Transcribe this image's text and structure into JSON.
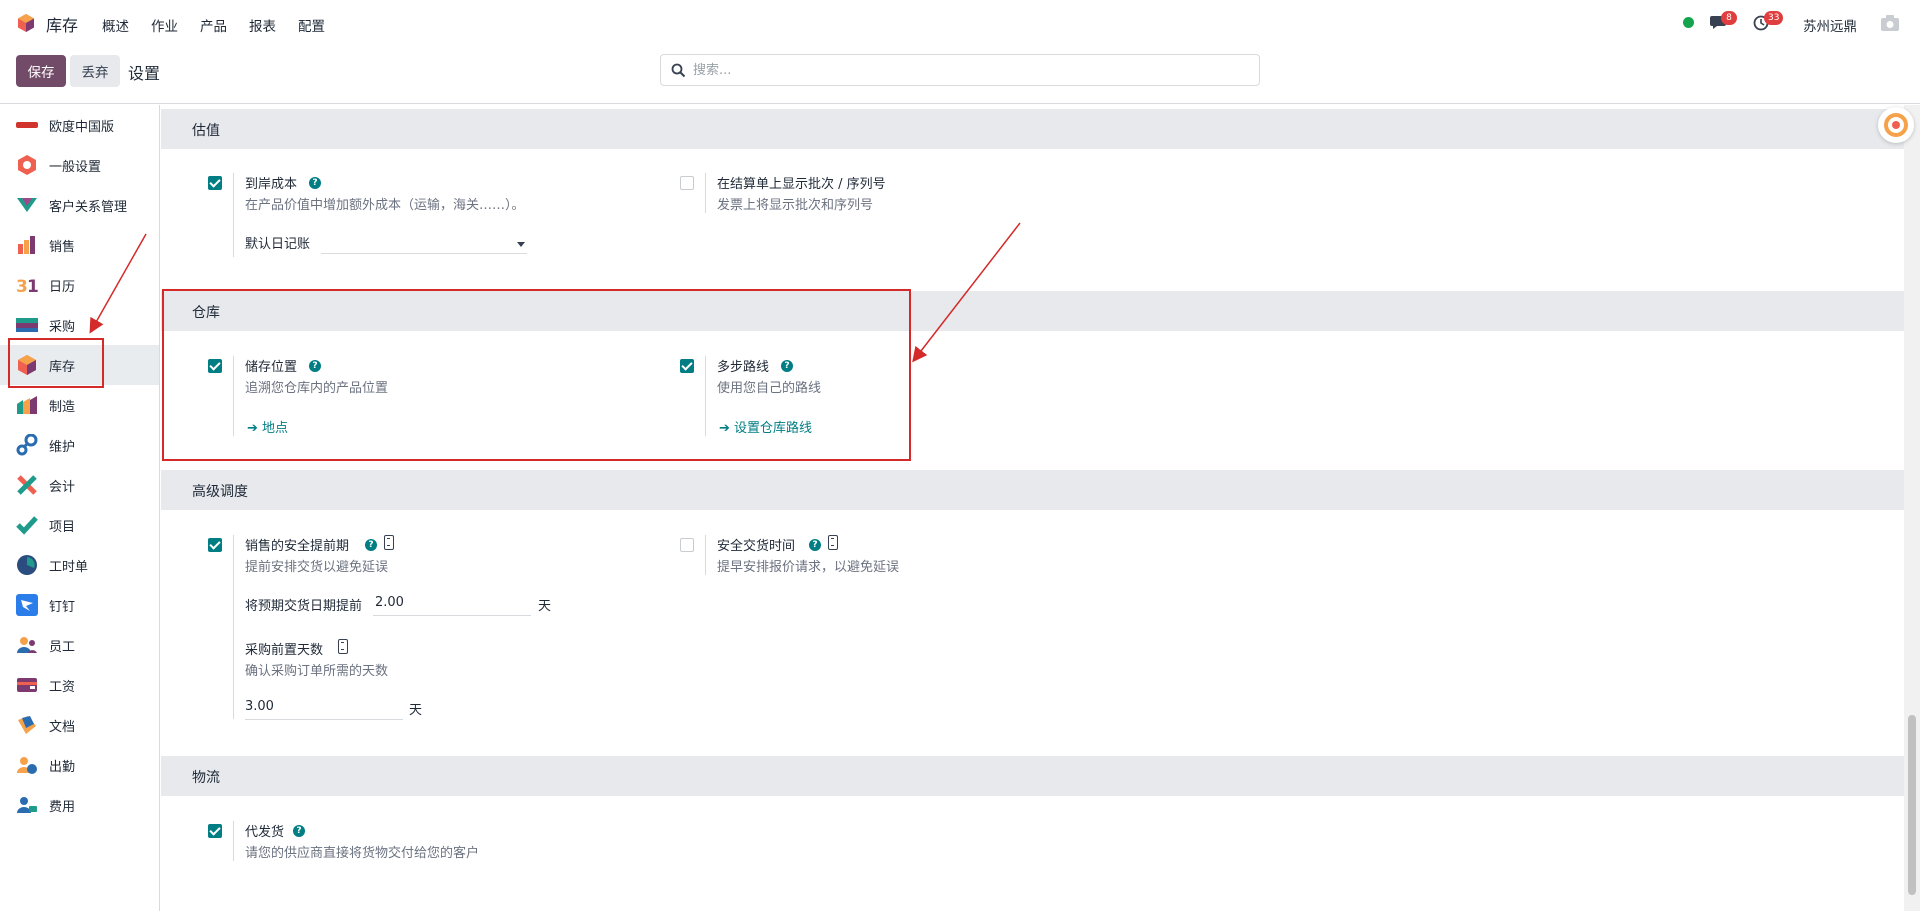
{
  "navbar": {
    "app_name": "库存",
    "menu": [
      "概述",
      "作业",
      "产品",
      "报表",
      "配置"
    ],
    "chat_count": "8",
    "activity_count": "33",
    "company": "苏州远鼎"
  },
  "control": {
    "save_label": "保存",
    "discard_label": "丢弃",
    "title": "设置",
    "search_placeholder": "搜索..."
  },
  "sidebar": {
    "items": [
      {
        "label": "欧度中国版",
        "icon": "odoo-china-icon"
      },
      {
        "label": "一般设置",
        "icon": "general-settings-icon"
      },
      {
        "label": "客户关系管理",
        "icon": "crm-icon"
      },
      {
        "label": "销售",
        "icon": "sales-icon"
      },
      {
        "label": "日历",
        "icon": "calendar-icon"
      },
      {
        "label": "采购",
        "icon": "purchase-icon"
      },
      {
        "label": "库存",
        "icon": "inventory-icon"
      },
      {
        "label": "制造",
        "icon": "manufacturing-icon"
      },
      {
        "label": "维护",
        "icon": "maintenance-icon"
      },
      {
        "label": "会计",
        "icon": "accounting-icon"
      },
      {
        "label": "项目",
        "icon": "project-icon"
      },
      {
        "label": "工时单",
        "icon": "timesheet-icon"
      },
      {
        "label": "钉钉",
        "icon": "dingtalk-icon"
      },
      {
        "label": "员工",
        "icon": "employees-icon"
      },
      {
        "label": "工资",
        "icon": "payroll-icon"
      },
      {
        "label": "文档",
        "icon": "documents-icon"
      },
      {
        "label": "出勤",
        "icon": "attendance-icon"
      },
      {
        "label": "费用",
        "icon": "expenses-icon"
      }
    ],
    "active": "库存"
  },
  "sections": {
    "valuation": {
      "title": "估值",
      "landed_cost": {
        "title": "到岸成本",
        "desc": "在产品价值中增加额外成本（运输，海关……）。",
        "checked": true,
        "field_label": "默认日记账"
      },
      "lot_on_invoice": {
        "title": "在结算单上显示批次 / 序列号",
        "desc": "发票上将显示批次和序列号",
        "checked": false
      }
    },
    "warehouse": {
      "title": "仓库",
      "storage_locations": {
        "title": "储存位置",
        "desc": "追溯您仓库内的产品位置",
        "checked": true,
        "link": "地点"
      },
      "multi_step_routes": {
        "title": "多步路线",
        "desc": "使用您自己的路线",
        "checked": true,
        "link": "设置仓库路线"
      }
    },
    "advanced_scheduling": {
      "title": "高级调度",
      "sales_security_lead": {
        "title": "销售的安全提前期",
        "desc": "提前安排交货以避免延误",
        "checked": true,
        "field_label": "将预期交货日期提前",
        "value": "2.00",
        "unit": "天"
      },
      "security_lead_time": {
        "title": "安全交货时间",
        "desc": "提早安排报价请求，以避免延误",
        "checked": false
      },
      "purchase_lead": {
        "title": "采购前置天数",
        "desc": "确认采购订单所需的天数",
        "value": "3.00",
        "unit": "天"
      }
    },
    "logistics": {
      "title": "物流",
      "dropship": {
        "title": "代发货",
        "desc": "请您的供应商直接将货物交付给您的客户",
        "checked": true
      }
    }
  },
  "colors": {
    "brand": "#714b67",
    "accent": "#017e84",
    "annotation": "#d42a2a"
  }
}
